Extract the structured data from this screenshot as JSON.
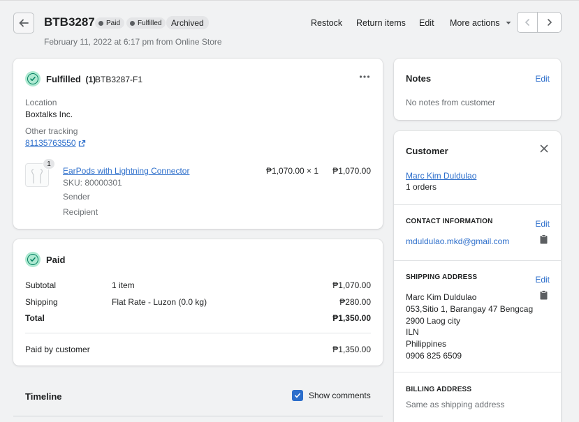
{
  "header": {
    "title": "BTB3287",
    "badges": [
      "Paid",
      "Fulfilled"
    ],
    "archived": "Archived",
    "subtitle": "February 11, 2022 at 6:17 pm from Online Store",
    "actions": {
      "restock": "Restock",
      "return_items": "Return items",
      "edit": "Edit",
      "more_actions": "More actions"
    }
  },
  "fulfilled": {
    "title": "Fulfilled",
    "count": "(1)",
    "fulfillment_id": "BTB3287-F1",
    "location_label": "Location",
    "location": "Boxtalks Inc.",
    "tracking_label": "Other tracking",
    "tracking_number": "81135763550",
    "item": {
      "quantity_badge": "1",
      "name": "EarPods with Lightning Connector",
      "sku": "SKU: 80000301",
      "sender": "Sender",
      "recipient": "Recipient",
      "unit_price": "₱1,070.00 × 1",
      "total": "₱1,070.00"
    }
  },
  "paid": {
    "title": "Paid",
    "rows": [
      {
        "label": "Subtotal",
        "desc": "1 item",
        "amount": "₱1,070.00"
      },
      {
        "label": "Shipping",
        "desc": "Flat Rate - Luzon (0.0 kg)",
        "amount": "₱280.00"
      },
      {
        "label": "Total",
        "desc": "",
        "amount": "₱1,350.00"
      }
    ],
    "paid_by_label": "Paid by customer",
    "paid_by_amount": "₱1,350.00"
  },
  "timeline": {
    "title": "Timeline",
    "show_comments": "Show comments",
    "show_comments_checked": true
  },
  "notes": {
    "title": "Notes",
    "edit": "Edit",
    "text": "No notes from customer"
  },
  "customer": {
    "title": "Customer",
    "name": "Marc Kim Duldulao",
    "orders": "1 orders",
    "contact_heading": "CONTACT INFORMATION",
    "contact_edit": "Edit",
    "email": "mduldulao.mkd@gmail.com",
    "shipping_heading": "SHIPPING ADDRESS",
    "shipping_edit": "Edit",
    "address_lines": [
      "Marc Kim Duldulao",
      "053,Sitio 1, Barangay 47 Bengcag",
      "2900 Laog city",
      "ILN",
      "Philippines",
      "0906 825 6509"
    ],
    "billing_heading": "BILLING ADDRESS",
    "billing_text": "Same as shipping address"
  },
  "colors": {
    "accent": "#2c6ecb",
    "success": "#007f5f",
    "success_bg": "#aee9d1",
    "checkbox": "#2c6ecb"
  }
}
